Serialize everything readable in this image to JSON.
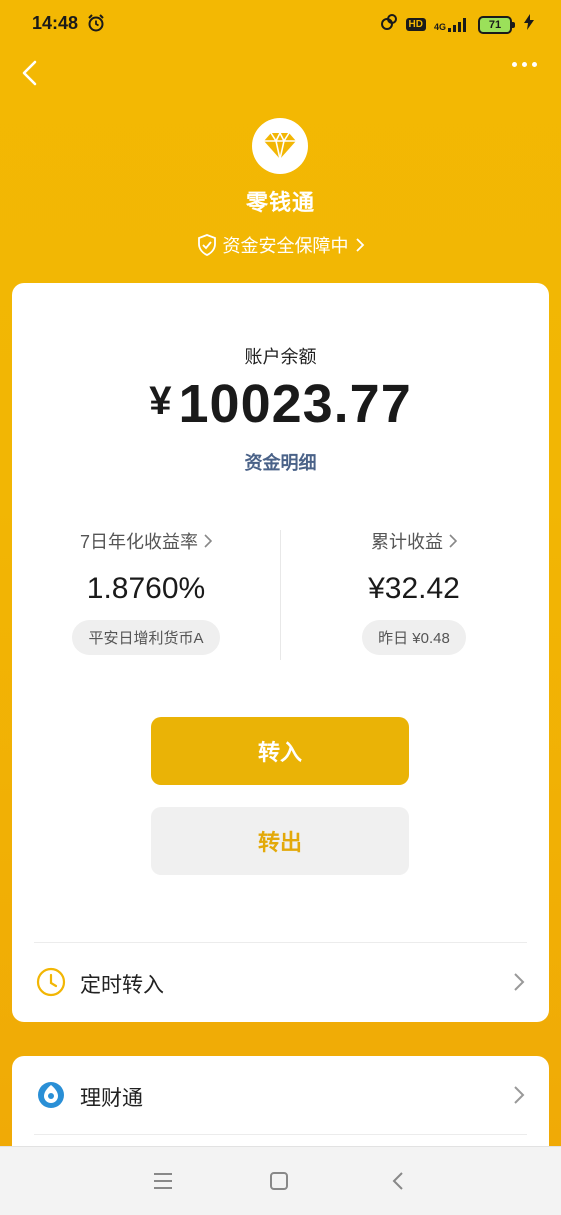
{
  "status_bar": {
    "time": "14:48",
    "alarm_icon": "alarm-clock-icon",
    "hd": "HD",
    "network": "4G",
    "battery": "71"
  },
  "header": {
    "title": "零钱通",
    "guarantee": "资金安全保障中"
  },
  "balance": {
    "label": "账户余额",
    "currency": "¥",
    "amount": "10023.77",
    "details_link": "资金明细"
  },
  "stats": {
    "yield": {
      "label": "7日年化收益率",
      "value": "1.8760%",
      "fund": "平安日增利货币A"
    },
    "earnings": {
      "label": "累计收益",
      "value": "¥32.42",
      "yesterday": "昨日 ¥0.48"
    }
  },
  "actions": {
    "transfer_in": "转入",
    "transfer_out": "转出"
  },
  "rows": {
    "scheduled": "定时转入",
    "wealth": "理财通"
  },
  "colors": {
    "brand_yellow": "#f2b604",
    "button_yellow": "#eab306",
    "link_blue": "#4a6288"
  }
}
